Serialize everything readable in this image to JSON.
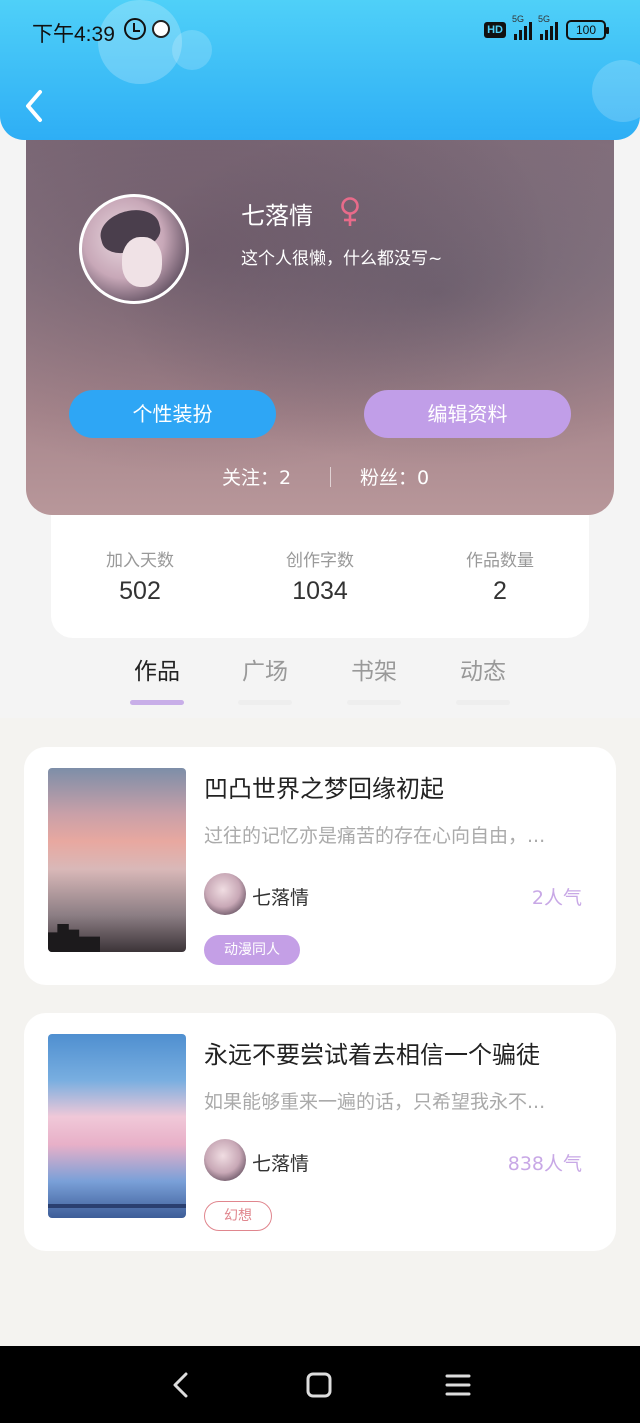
{
  "status_bar": {
    "time": "下午4:39",
    "hd_label": "HD",
    "signal1_label": "5G",
    "signal2_label": "5G",
    "battery": "100"
  },
  "profile": {
    "name": "七落情",
    "gender_icon": "female-icon",
    "bio": "这个人很懒，什么都没写~",
    "dressup_label": "个性装扮",
    "edit_label": "编辑资料",
    "following": "关注：2",
    "fans": "粉丝：0"
  },
  "stats": [
    {
      "label": "加入天数",
      "value": "502"
    },
    {
      "label": "创作字数",
      "value": "1034"
    },
    {
      "label": "作品数量",
      "value": "2"
    }
  ],
  "tabs": [
    {
      "label": "作品",
      "active": true
    },
    {
      "label": "广场",
      "active": false
    },
    {
      "label": "书架",
      "active": false
    },
    {
      "label": "动态",
      "active": false
    }
  ],
  "works": [
    {
      "title": "凹凸世界之梦回缘初起",
      "summary": "过往的记忆亦是痛苦的存在心向自由，...",
      "author": "七落情",
      "popularity": "2人气",
      "tag": "动漫同人"
    },
    {
      "title": "永远不要尝试着去相信一个骗徒",
      "summary": "如果能够重来一遍的话，只希望我永不...",
      "author": "七落情",
      "popularity": "838人气",
      "tag": "幻想"
    }
  ],
  "colors": {
    "header_blue": "#2eaef5",
    "dressup_button": "#2ea6f5",
    "edit_button": "#c19ee8",
    "tab_indicator": "#c8aee8",
    "popularity": "#c8a8e6",
    "tag_fantasy": "#e0868e",
    "gender_pink": "#e86b8a"
  }
}
